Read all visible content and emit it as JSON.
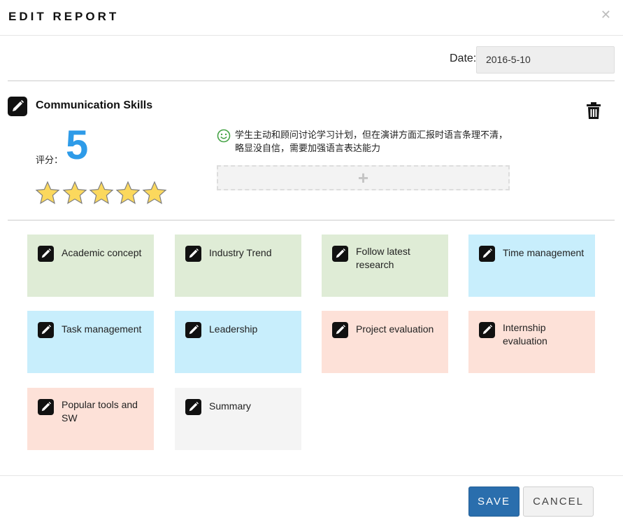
{
  "modal": {
    "title": "EDIT REPORT",
    "close_icon": "close-icon"
  },
  "date": {
    "label": "Date:",
    "value": "2016-5-10"
  },
  "skill": {
    "title": "Communication Skills",
    "score_label": "评分：",
    "score": "5",
    "rating": 5,
    "rating_max": 5,
    "comment": "学生主动和顾问讨论学习计划，但在演讲方面汇报时语言条理不清，略显没自信，需要加强语言表达能力",
    "add_label": "+",
    "colors": {
      "score": "#2e9be8",
      "star_fill": "#fbd85d",
      "smile": "#46a346"
    }
  },
  "categories": [
    {
      "label": "Academic concept",
      "color": "#dfecd6"
    },
    {
      "label": "Industry Trend",
      "color": "#dfecd6"
    },
    {
      "label": "Follow latest research",
      "color": "#dfecd6"
    },
    {
      "label": "Time management",
      "color": "#c8eefc"
    },
    {
      "label": "Task management",
      "color": "#c8eefc"
    },
    {
      "label": "Leadership",
      "color": "#c8eefc"
    },
    {
      "label": "Project evaluation",
      "color": "#fde1d8"
    },
    {
      "label": "Internship evaluation",
      "color": "#fde1d8"
    },
    {
      "label": "Popular tools and SW",
      "color": "#fde1d8"
    },
    {
      "label": "Summary",
      "color": "#f4f4f4"
    }
  ],
  "footer": {
    "save_label": "SAVE",
    "cancel_label": "CANCEL",
    "save_color": "#2a6ead"
  }
}
